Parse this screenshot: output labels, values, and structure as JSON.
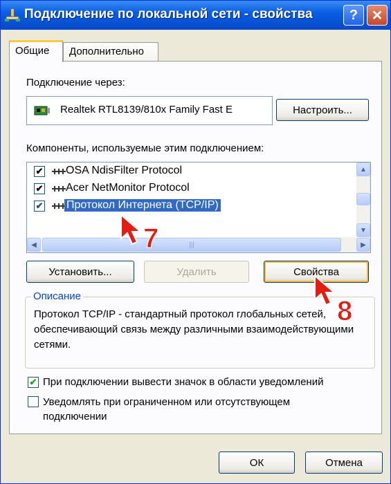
{
  "window": {
    "title": "Подключение по локальной сети - свойства",
    "help_glyph": "?",
    "close_glyph": "✕"
  },
  "tabs": [
    "Общие",
    "Дополнительно"
  ],
  "connection": {
    "via_label": "Подключение через:",
    "adapter_name": "Realtek RTL8139/810x Family Fast E",
    "configure_label": "Настроить..."
  },
  "components": {
    "label": "Компоненты, используемые этим подключением:",
    "items": [
      {
        "label": "OSA NdisFilter Protocol",
        "checked": true,
        "selected": false
      },
      {
        "label": "Acer NetMonitor Protocol",
        "checked": true,
        "selected": false
      },
      {
        "label": "Протокол Интернета (TCP/IP)",
        "checked": true,
        "selected": true
      }
    ]
  },
  "buttons": {
    "install": "Установить...",
    "remove": "Удалить",
    "properties": "Свойства",
    "ok": "ОК",
    "cancel": "Отмена"
  },
  "description": {
    "title": "Описание",
    "text": "Протокол TCP/IP - стандартный протокол глобальных сетей, обеспечивающий связь между различными взаимодействующими сетями."
  },
  "options": {
    "show_icon": {
      "label": "При подключении вывести значок в области уведомлений",
      "checked": true
    },
    "notify_limited": {
      "label": "Уведомлять при ограниченном или отсутствующем подключении",
      "checked": false
    }
  },
  "annotations": {
    "step_7": "7",
    "step_8": "8"
  },
  "colors": {
    "titlebar": "#0654d8",
    "selection": "#316ac5",
    "annotation": "#e21d12"
  }
}
